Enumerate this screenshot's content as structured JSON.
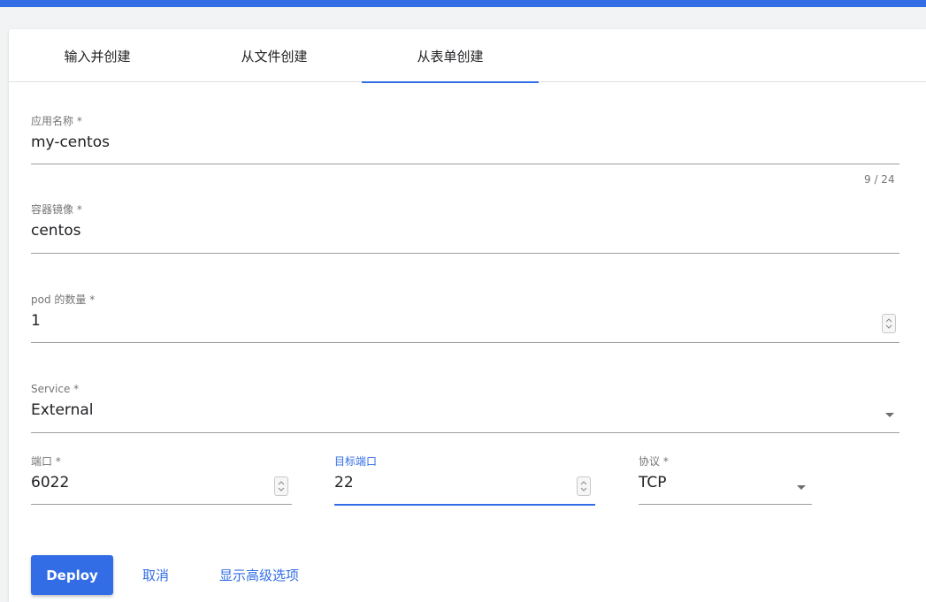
{
  "tabs": [
    {
      "label": "输入并创建"
    },
    {
      "label": "从文件创建"
    },
    {
      "label": "从表单创建",
      "active": true
    }
  ],
  "form": {
    "app_name": {
      "label": "应用名称 *",
      "value": "my-centos",
      "counter": "9 / 24"
    },
    "image": {
      "label": "容器镜像 *",
      "value": "centos"
    },
    "pod_count": {
      "label": "pod 的数量 *",
      "value": "1"
    },
    "service": {
      "label": "Service *",
      "value": "External"
    },
    "port": {
      "label": "端口 *",
      "value": "6022"
    },
    "target_port": {
      "label": "目标端口",
      "value": "22"
    },
    "protocol": {
      "label": "协议 *",
      "value": "TCP"
    }
  },
  "actions": {
    "deploy_label": "Deploy",
    "cancel_label": "取消",
    "advanced_label": "显示高级选项"
  },
  "colors": {
    "accent": "#326de6",
    "label": "#757575",
    "underline": "#9e9e9e"
  }
}
